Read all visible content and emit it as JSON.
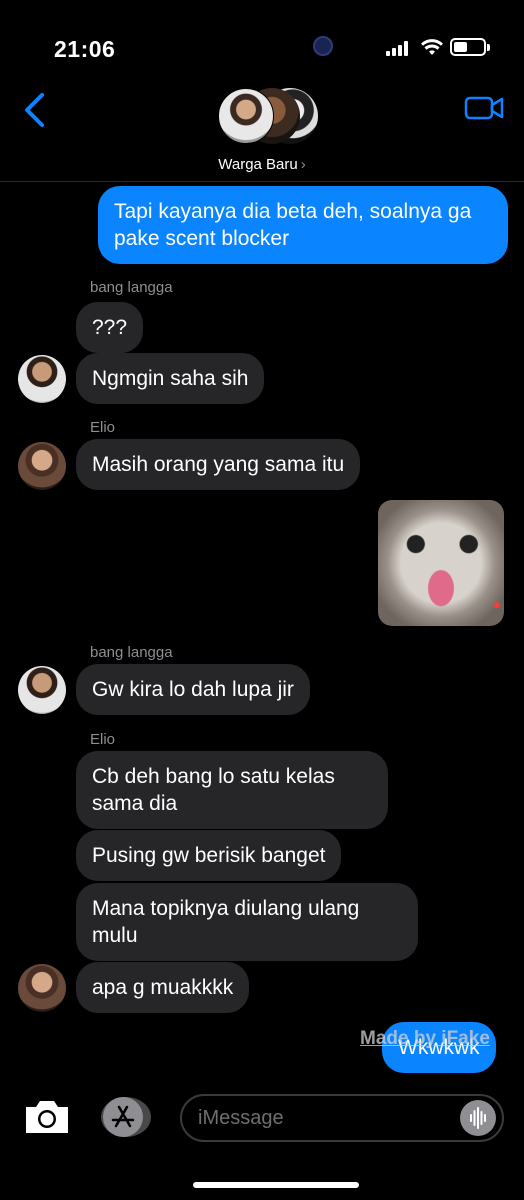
{
  "status_bar": {
    "time": "21:06"
  },
  "header": {
    "group_name": "Warga Baru",
    "chevron": "›"
  },
  "messages": [
    {
      "type": "outgoing",
      "text": "Tapi kayanya dia beta deh, soalnya ga pake scent blocker"
    },
    {
      "type": "sender_label",
      "text": "bang langga"
    },
    {
      "type": "incoming",
      "sender": "bang langga",
      "text": "???"
    },
    {
      "type": "incoming",
      "sender": "bang langga",
      "text": "Ngmgin saha sih"
    },
    {
      "type": "sender_label",
      "text": "Elio"
    },
    {
      "type": "incoming",
      "sender": "Elio",
      "text": "Masih orang yang sama itu"
    },
    {
      "type": "sticker",
      "icon": "cat-sticker"
    },
    {
      "type": "sender_label",
      "text": "bang langga"
    },
    {
      "type": "incoming",
      "sender": "bang langga",
      "text": "Gw kira lo dah lupa jir"
    },
    {
      "type": "sender_label",
      "text": "Elio"
    },
    {
      "type": "incoming",
      "sender": "Elio",
      "text": "Cb deh bang lo satu kelas sama dia"
    },
    {
      "type": "incoming",
      "sender": "Elio",
      "text": "Pusing gw berisik banget"
    },
    {
      "type": "incoming",
      "sender": "Elio",
      "text": "Mana topiknya diulang ulang mulu"
    },
    {
      "type": "incoming",
      "sender": "Elio",
      "text": "apa g muakkkk"
    },
    {
      "type": "outgoing",
      "text": "Wkwkwk"
    }
  ],
  "watermark": "Made by iFake",
  "composer": {
    "placeholder": "iMessage"
  },
  "colors": {
    "outgoing": "#0a84ff",
    "incoming": "#262628",
    "accent": "#0a84ff"
  }
}
